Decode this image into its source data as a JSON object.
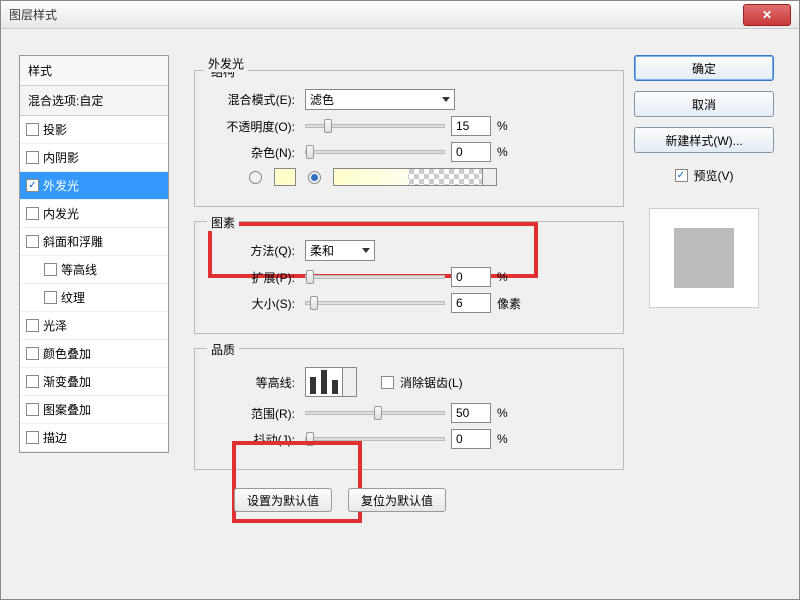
{
  "window": {
    "title": "图层样式"
  },
  "left": {
    "header": "样式",
    "subheader": "混合选项:自定",
    "items": [
      {
        "label": "投影",
        "checked": false
      },
      {
        "label": "内阴影",
        "checked": false
      },
      {
        "label": "外发光",
        "checked": true,
        "selected": true
      },
      {
        "label": "内发光",
        "checked": false
      },
      {
        "label": "斜面和浮雕",
        "checked": false
      },
      {
        "label": "等高线",
        "checked": false,
        "indent": true
      },
      {
        "label": "纹理",
        "checked": false,
        "indent": true
      },
      {
        "label": "光泽",
        "checked": false
      },
      {
        "label": "颜色叠加",
        "checked": false
      },
      {
        "label": "渐变叠加",
        "checked": false
      },
      {
        "label": "图案叠加",
        "checked": false
      },
      {
        "label": "描边",
        "checked": false
      }
    ]
  },
  "mid": {
    "title": "外发光",
    "struct": {
      "legend": "结构",
      "blend_label": "混合模式(E):",
      "blend_value": "滤色",
      "opacity_label": "不透明度(O):",
      "opacity_value": "15",
      "opacity_unit": "%",
      "noise_label": "杂色(N):",
      "noise_value": "0",
      "noise_unit": "%"
    },
    "elements": {
      "legend": "图素",
      "tech_label": "方法(Q):",
      "tech_value": "柔和",
      "spread_label": "扩展(P):",
      "spread_value": "0",
      "spread_unit": "%",
      "size_label": "大小(S):",
      "size_value": "6",
      "size_unit": "像素"
    },
    "quality": {
      "legend": "品质",
      "contour_label": "等高线:",
      "aa_label": "消除锯齿(L)",
      "range_label": "范围(R):",
      "range_value": "50",
      "range_unit": "%",
      "jitter_label": "抖动(J):",
      "jitter_value": "0",
      "jitter_unit": "%"
    },
    "bottom": {
      "set_default": "设置为默认值",
      "reset_default": "复位为默认值"
    }
  },
  "right": {
    "ok": "确定",
    "cancel": "取消",
    "new_style": "新建样式(W)...",
    "preview_label": "预览(V)"
  }
}
